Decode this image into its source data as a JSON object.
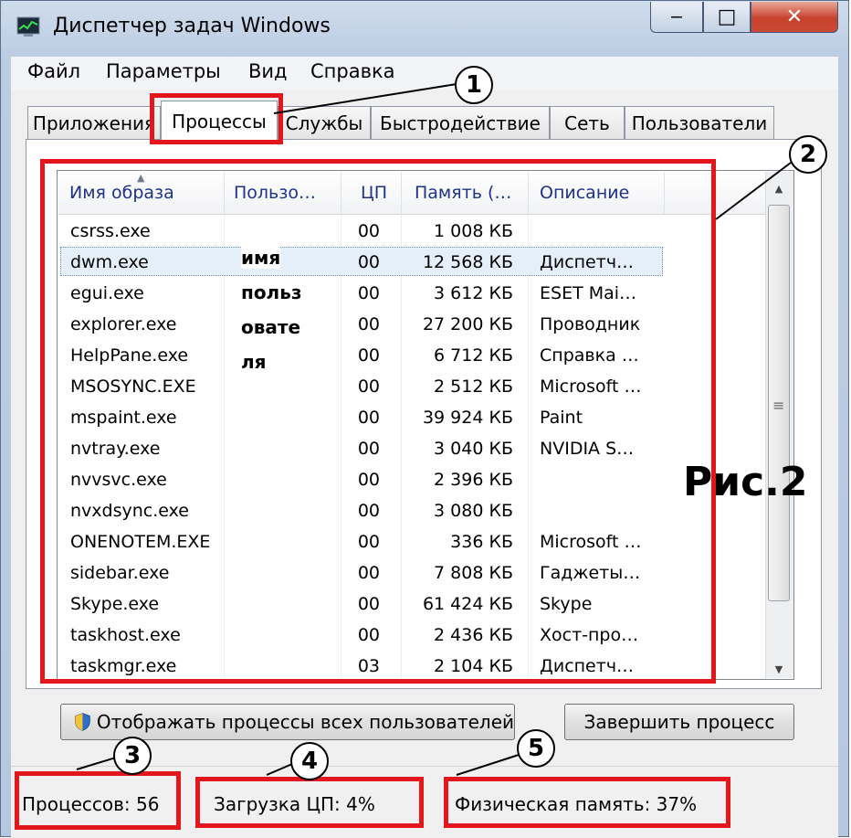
{
  "window": {
    "title": "Диспетчер задач Windows",
    "minimize": "‒",
    "maximize": "□",
    "close": "✕"
  },
  "menu": [
    "Файл",
    "Параметры",
    "Вид",
    "Справка"
  ],
  "tabs": [
    "Приложения",
    "Процессы",
    "Службы",
    "Быстродействие",
    "Сеть",
    "Пользователи"
  ],
  "active_tab": "Процессы",
  "columns": [
    "Имя образа",
    "Пользо…",
    "ЦП",
    "Память (…",
    "Описание"
  ],
  "sort_indicator": "▲",
  "rows": [
    [
      "csrss.exe",
      "",
      "00",
      "1 008 КБ",
      ""
    ],
    [
      "dwm.exe",
      "",
      "00",
      "12 568 КБ",
      "Диспетч…"
    ],
    [
      "egui.exe",
      "",
      "00",
      "3 612 КБ",
      "ESET Mai…"
    ],
    [
      "explorer.exe",
      "",
      "00",
      "27 200 КБ",
      "Проводник"
    ],
    [
      "HelpPane.exe",
      "",
      "00",
      "6 712 КБ",
      "Справка …"
    ],
    [
      "MSOSYNC.EXE",
      "",
      "00",
      "2 512 КБ",
      "Microsoft …"
    ],
    [
      "mspaint.exe",
      "",
      "00",
      "39 924 КБ",
      "Paint"
    ],
    [
      "nvtray.exe",
      "",
      "00",
      "3 040 КБ",
      "NVIDIA S…"
    ],
    [
      "nvvsvc.exe",
      "",
      "00",
      "2 396 КБ",
      ""
    ],
    [
      "nvxdsync.exe",
      "",
      "00",
      "3 080 КБ",
      ""
    ],
    [
      "ONENOTEM.EXE",
      "",
      "00",
      "336 КБ",
      "Microsoft …"
    ],
    [
      "sidebar.exe",
      "",
      "00",
      "7 808 КБ",
      "Гаджеты…"
    ],
    [
      "Skype.exe",
      "",
      "00",
      "61 424 КБ",
      "Skype"
    ],
    [
      "taskhost.exe",
      "",
      "00",
      "2 436 КБ",
      "Хост-про…"
    ],
    [
      "taskmgr.exe",
      "",
      "03",
      "2 104 КБ",
      "Диспетч…"
    ]
  ],
  "selected_row": 1,
  "user_overlay": [
    "имя",
    "польз",
    "овате",
    "ля"
  ],
  "figure_label": "Рис.2",
  "buttons": {
    "show_all": "Отображать процессы всех пользователей",
    "end_process": "Завершить процесс"
  },
  "status": {
    "processes": "Процессов: 56",
    "cpu": "Загрузка ЦП: 4%",
    "memory": "Физическая память: 37%"
  },
  "callouts": [
    "1",
    "2",
    "3",
    "4",
    "5"
  ],
  "scroll": {
    "up": "▲",
    "down": "▼",
    "grip": "≡"
  },
  "colors": {
    "annotation_red": "#e3161d",
    "header_text": "#1e3287",
    "selection": "#e5effa"
  }
}
